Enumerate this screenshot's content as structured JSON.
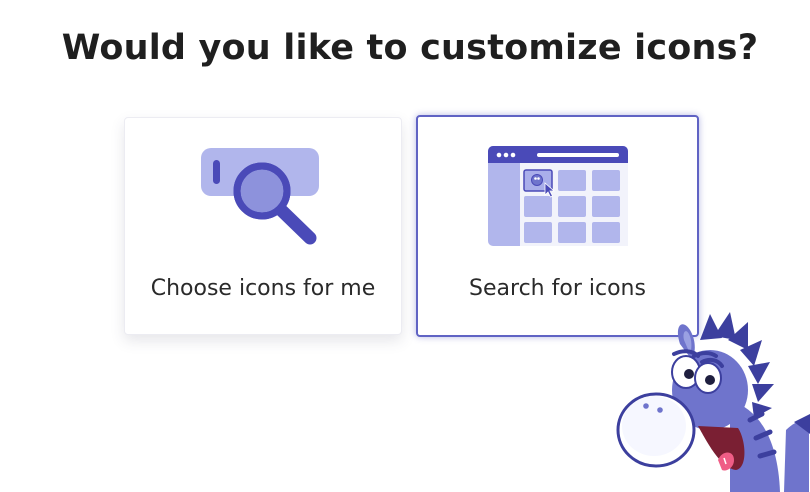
{
  "heading": "Would you like to customize icons?",
  "options": [
    {
      "label": "Choose icons for me",
      "icon": "magnifier-icon",
      "selected": false
    },
    {
      "label": "Search for icons",
      "icon": "icon-grid-browser-icon",
      "selected": true
    }
  ],
  "colors": {
    "accent": "#6063c4",
    "illustration_dark": "#4a4ab8",
    "illustration_light": "#b1b6ec",
    "text": "#1f1f1f"
  },
  "mascot": "donkey-mascot"
}
